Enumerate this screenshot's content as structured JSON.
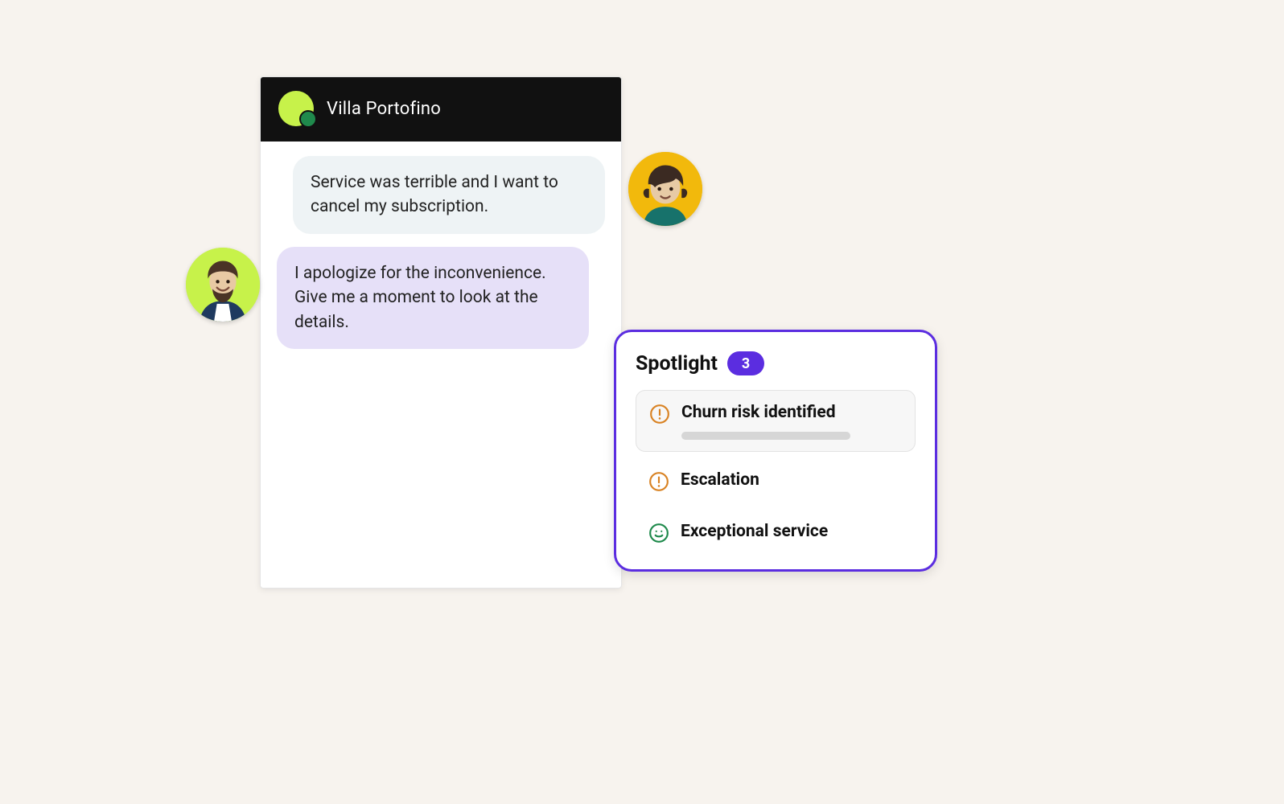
{
  "chat": {
    "title": "Villa Portofino",
    "messages": [
      {
        "role": "customer",
        "text": "Service was terrible and I want to cancel my subscription."
      },
      {
        "role": "agent",
        "text": "I apologize for the inconvenience. Give me a moment to look at the details."
      }
    ]
  },
  "spotlight": {
    "title": "Spotlight",
    "count": "3",
    "items": [
      {
        "icon": "alert-circle-icon",
        "label": "Churn risk identified",
        "selected": true,
        "has_sub": true
      },
      {
        "icon": "alert-circle-icon",
        "label": "Escalation",
        "selected": false,
        "has_sub": false
      },
      {
        "icon": "smile-icon",
        "label": "Exceptional service",
        "selected": false,
        "has_sub": false
      }
    ]
  },
  "avatars": {
    "customer_bg": "#f2b90c",
    "agent_bg": "#c7f24a"
  },
  "colors": {
    "accent": "#5b2de0",
    "warning": "#d98324",
    "positive": "#1f8a4c"
  }
}
